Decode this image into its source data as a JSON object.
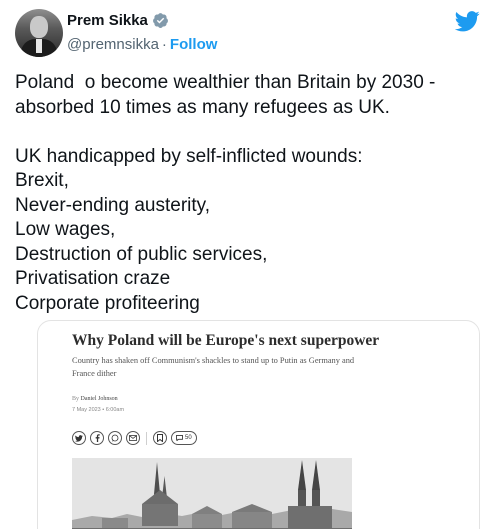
{
  "user": {
    "display_name": "Prem Sikka",
    "handle": "@premnsikka",
    "separator": "·",
    "follow_label": "Follow"
  },
  "tweet": {
    "text": "Poland  o become wealthier than Britain by 2030 - absorbed 10 times as many refugees as UK.\n\nUK handicapped by self-inflicted wounds:\nBrexit,\nNever-ending austerity,\nLow wages,\nDestruction of public services,\nPrivatisation craze\nCorporate profiteering"
  },
  "article_card": {
    "headline": "Why Poland will be Europe's next superpower",
    "standfirst": "Country has shaken off Communism's shackles to stand up to Putin as Germany and France dither",
    "byline_prefix": "By",
    "author": "Daniel Johnson",
    "date": "7 May 2023 • 6:00am",
    "comment_count": "50"
  },
  "icons": {
    "verified": "verified-badge-icon",
    "twitter": "twitter-bird-icon",
    "share": [
      "twitter-icon",
      "facebook-icon",
      "whatsapp-icon",
      "email-icon",
      "bookmark-icon",
      "comment-icon"
    ]
  },
  "colors": {
    "twitter_blue": "#1d9bf0",
    "verified_gray": "#829aab",
    "secondary_text": "#536471"
  }
}
